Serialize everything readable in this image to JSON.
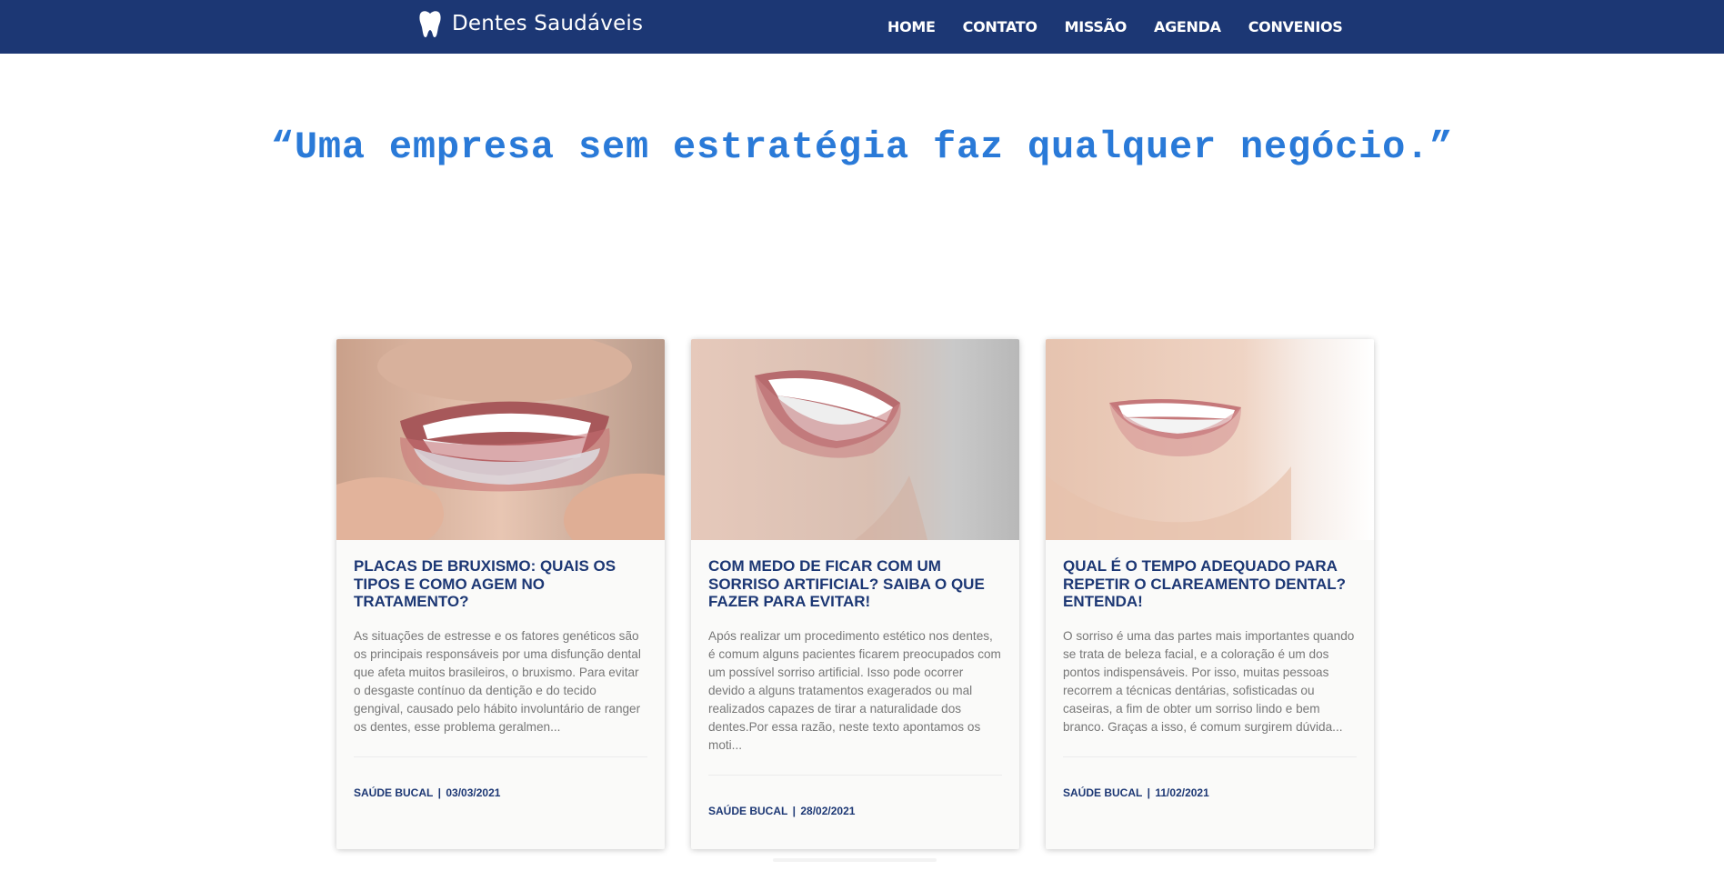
{
  "header": {
    "brand_name": "Dentes Saudáveis",
    "brand_icon": "tooth-icon",
    "background_color": "#1c3774",
    "nav": [
      "HOME",
      "CONTATO",
      "MISSÃO",
      "AGENDA",
      "CONVENIOS"
    ]
  },
  "quote": "“Uma empresa sem estratégia faz qualquer negócio.”",
  "quote_color": "#2a7ad8",
  "cards": [
    {
      "title": "PLACAS DE BRUXISMO: QUAIS OS TIPOS E COMO AGEM NO TRATAMENTO?",
      "excerpt": "As situações de estresse e os fatores genéticos são os principais responsáveis por uma disfunção dental que afeta muitos brasileiros, o bruxismo. Para evitar o desgaste contínuo da dentição e do tecido gengival, causado pelo hábito involuntário de ranger os dentes, esse problema geralmen...",
      "category": "SAÚDE BUCAL",
      "date": "03/03/2021",
      "image": "smile-with-night-guard-photo"
    },
    {
      "title": "COM MEDO DE FICAR COM UM SORRISO ARTIFICIAL? SAIBA O QUE FAZER PARA EVITAR!",
      "excerpt": "Após realizar um procedimento estético nos dentes, é comum alguns pacientes ficarem preocupados com um possível sorriso artificial. Isso pode ocorrer devido a alguns tratamentos exagerados ou mal realizados capazes de tirar a naturalidade dos dentes.Por essa razão, neste texto apontamos os moti...",
      "category": "SAÚDE BUCAL",
      "date": "28/02/2021",
      "image": "smile-close-up-photo"
    },
    {
      "title": "QUAL É O TEMPO ADEQUADO PARA REPETIR O CLAREAMENTO DENTAL? ENTENDA!",
      "excerpt": "O sorriso é uma das partes mais importantes quando se trata de beleza facial, e a coloração é um dos pontos indispensáveis. Por isso, muitas pessoas recorrem a técnicas dentárias, sofisticadas ou caseiras, a fim de obter um sorriso lindo e bem branco. Graças a isso, é comum surgirem dúvida...",
      "category": "SAÚDE BUCAL",
      "date": "11/02/2021",
      "image": "white-smile-photo"
    }
  ]
}
